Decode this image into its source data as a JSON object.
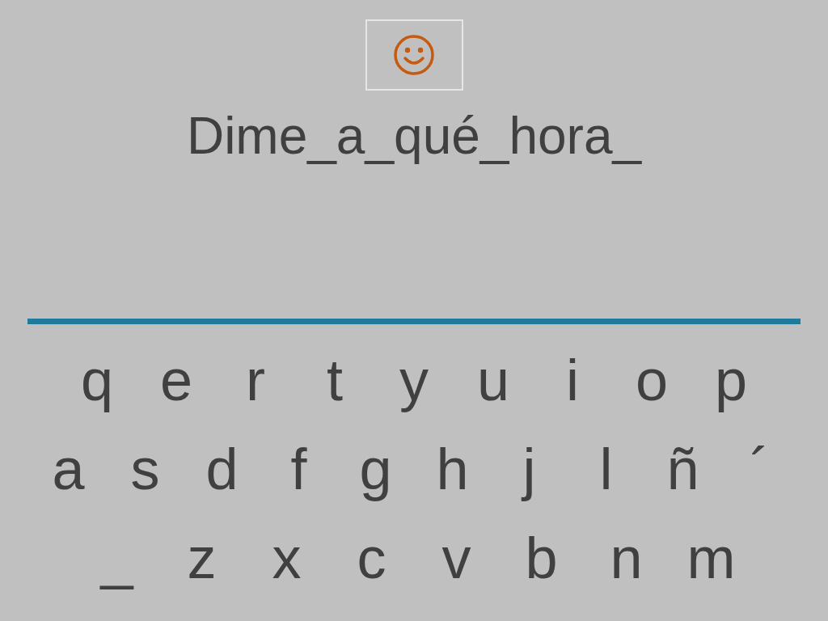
{
  "prompt": {
    "text": "Dime_a_qué_hora_"
  },
  "keyboard": {
    "rows": [
      {
        "keys": [
          "q",
          "e",
          "r",
          "t",
          "y",
          "u",
          "i",
          "o",
          "p"
        ]
      },
      {
        "keys": [
          "a",
          "s",
          "d",
          "f",
          "g",
          "h",
          "j",
          "l",
          "ñ",
          "´"
        ]
      },
      {
        "keys": [
          "_",
          "z",
          "x",
          "c",
          "v",
          "b",
          "n",
          "m"
        ]
      }
    ]
  }
}
